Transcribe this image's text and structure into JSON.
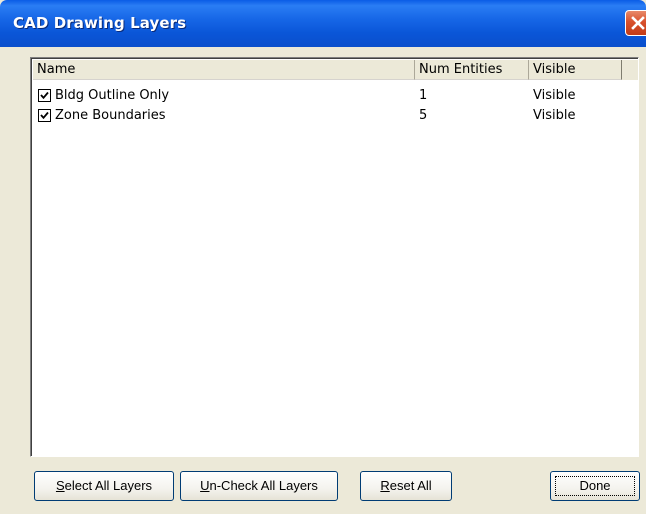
{
  "window": {
    "title": "CAD Drawing Layers"
  },
  "list": {
    "columns": [
      "Name",
      "Num Entities",
      "Visible"
    ],
    "rows": [
      {
        "checked": true,
        "name": "Bldg Outline Only",
        "entities": "1",
        "visible": "Visible"
      },
      {
        "checked": true,
        "name": "Zone Boundaries",
        "entities": "5",
        "visible": "Visible"
      }
    ]
  },
  "buttons": {
    "select_all": {
      "mnemonic": "S",
      "rest": "elect All Layers"
    },
    "uncheck_all": {
      "mnemonic": "U",
      "rest": "n-Check All Layers"
    },
    "reset_all": {
      "mnemonic": "R",
      "rest": "eset All"
    },
    "done": "Done"
  },
  "icons": {
    "close": "close-icon",
    "checkbox": "checkmark-icon"
  }
}
